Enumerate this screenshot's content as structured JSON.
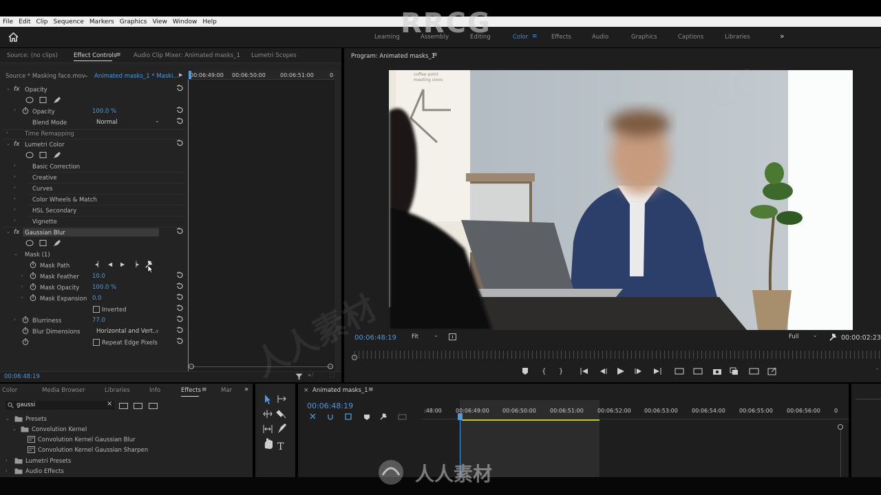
{
  "menu": [
    "File",
    "Edit",
    "Clip",
    "Sequence",
    "Markers",
    "Graphics",
    "View",
    "Window",
    "Help"
  ],
  "workspaces": [
    {
      "label": "Learning",
      "active": false
    },
    {
      "label": "Assembly",
      "active": false
    },
    {
      "label": "Editing",
      "active": false
    },
    {
      "label": "Color",
      "active": true
    },
    {
      "label": "Effects",
      "active": false
    },
    {
      "label": "Audio",
      "active": false
    },
    {
      "label": "Graphics",
      "active": false
    },
    {
      "label": "Captions",
      "active": false
    },
    {
      "label": "Libraries",
      "active": false
    }
  ],
  "watermark": {
    "top": "RRCG",
    "bottom": "人人素材",
    "diag1": "RRCG",
    "diag2": "人人素材"
  },
  "effect_panel": {
    "tabs": {
      "source": "Source: (no clips)",
      "effect_controls": "Effect Controls",
      "audio_mixer": "Audio Clip Mixer: Animated masks_1",
      "lumetri_scopes": "Lumetri Scopes"
    },
    "source_label": "Source * Masking face.mov",
    "sequence_label": "Animated masks_1 * Maski...",
    "ruler": [
      "00:06:49:00",
      "00:06:50:00",
      "00:06:51:00",
      "0"
    ],
    "opacity_section": "Opacity",
    "opacity_label": "Opacity",
    "opacity_value": "100.0 %",
    "blend_mode_label": "Blend Mode",
    "blend_mode_value": "Normal",
    "time_remapping": "Time Remapping",
    "lumetri_color": "Lumetri Color",
    "basic_correction": "Basic Correction",
    "creative": "Creative",
    "curves": "Curves",
    "color_wheels": "Color Wheels & Match",
    "hsl_secondary": "HSL Secondary",
    "vignette": "Vignette",
    "gaussian_blur": "Gaussian Blur",
    "mask_title": "Mask (1)",
    "mask_path": "Mask Path",
    "mask_feather_label": "Mask Feather",
    "mask_feather_value": "10.0",
    "mask_opacity_label": "Mask Opacity",
    "mask_opacity_value": "100.0 %",
    "mask_expansion_label": "Mask Expansion",
    "mask_expansion_value": "0.0",
    "inverted": "Inverted",
    "blurriness_label": "Blurriness",
    "blurriness_value": "77.0",
    "blur_dimensions_label": "Blur Dimensions",
    "blur_dimensions_value": "Horizontal and Vert...",
    "repeat_edge": "Repeat Edge Pixels",
    "timecode": "00:06:48:19"
  },
  "program": {
    "title": "Program: Animated masks_1",
    "timecode": "00:06:48:19",
    "fit": "Fit",
    "quality": "Full",
    "duration": "00:00:02:23"
  },
  "effects_panel": {
    "tabs": [
      "Color",
      "Media Browser",
      "Libraries",
      "Info",
      "Effects",
      "Mar"
    ],
    "search_value": "gaussi",
    "tree": [
      {
        "label": "Presets",
        "level": 0,
        "icon": "folder"
      },
      {
        "label": "Convolution Kernel",
        "level": 1,
        "icon": "folder"
      },
      {
        "label": "Convolution Kernel Gaussian Blur",
        "level": 2,
        "icon": "preset"
      },
      {
        "label": "Convolution Kernel Gaussian Sharpen",
        "level": 2,
        "icon": "preset"
      },
      {
        "label": "Lumetri Presets",
        "level": 0,
        "icon": "folder"
      },
      {
        "label": "Audio Effects",
        "level": 0,
        "icon": "folder"
      }
    ]
  },
  "timeline": {
    "tab": "Animated masks_1",
    "timecode": "00:06:48:19",
    "ruler": [
      ":48:00",
      "00:06:49:00",
      "00:06:50:00",
      "00:06:51:00",
      "00:06:52:00",
      "00:06:53:00",
      "00:06:54:00",
      "00:06:55:00",
      "00:06:56:00",
      "0"
    ]
  },
  "video_sign": {
    "line1": "coffee point",
    "line2": "meeting room"
  }
}
